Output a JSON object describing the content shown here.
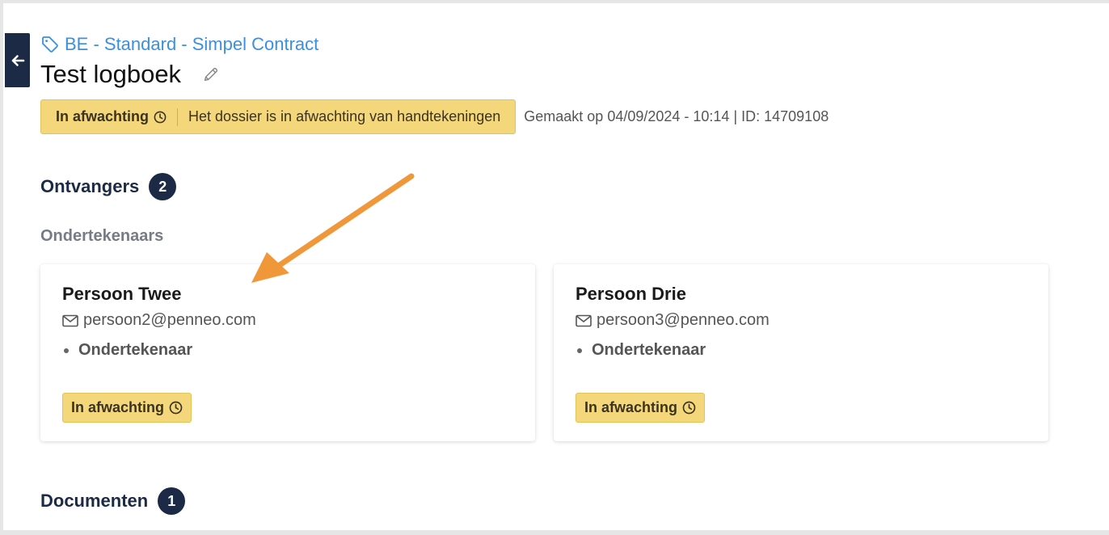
{
  "contract": {
    "tag": "BE - Standard - Simpel Contract",
    "title": "Test logboek"
  },
  "status": {
    "label": "In afwachting",
    "message": "Het dossier is in afwachting van handtekeningen",
    "meta": "Gemaakt op 04/09/2024 - 10:14 | ID: 14709108"
  },
  "recipients": {
    "heading": "Ontvangers",
    "count": "2",
    "group_label": "Ondertekenaars",
    "cards": [
      {
        "name": "Persoon Twee",
        "email": "persoon2@penneo.com",
        "role": "Ondertekenaar",
        "status": "In afwachting"
      },
      {
        "name": "Persoon Drie",
        "email": "persoon3@penneo.com",
        "role": "Ondertekenaar",
        "status": "In afwachting"
      }
    ]
  },
  "documents": {
    "heading": "Documenten",
    "count": "1"
  },
  "icons": {
    "back": "arrow-left-icon",
    "tag": "tag-icon",
    "edit": "pencil-icon",
    "clock": "clock-icon",
    "mail": "envelope-icon"
  },
  "colors": {
    "navy": "#1c2a45",
    "link_blue": "#3b8fe0",
    "pending_yellow": "#f5d77b",
    "annotation_orange": "#f0973a"
  }
}
